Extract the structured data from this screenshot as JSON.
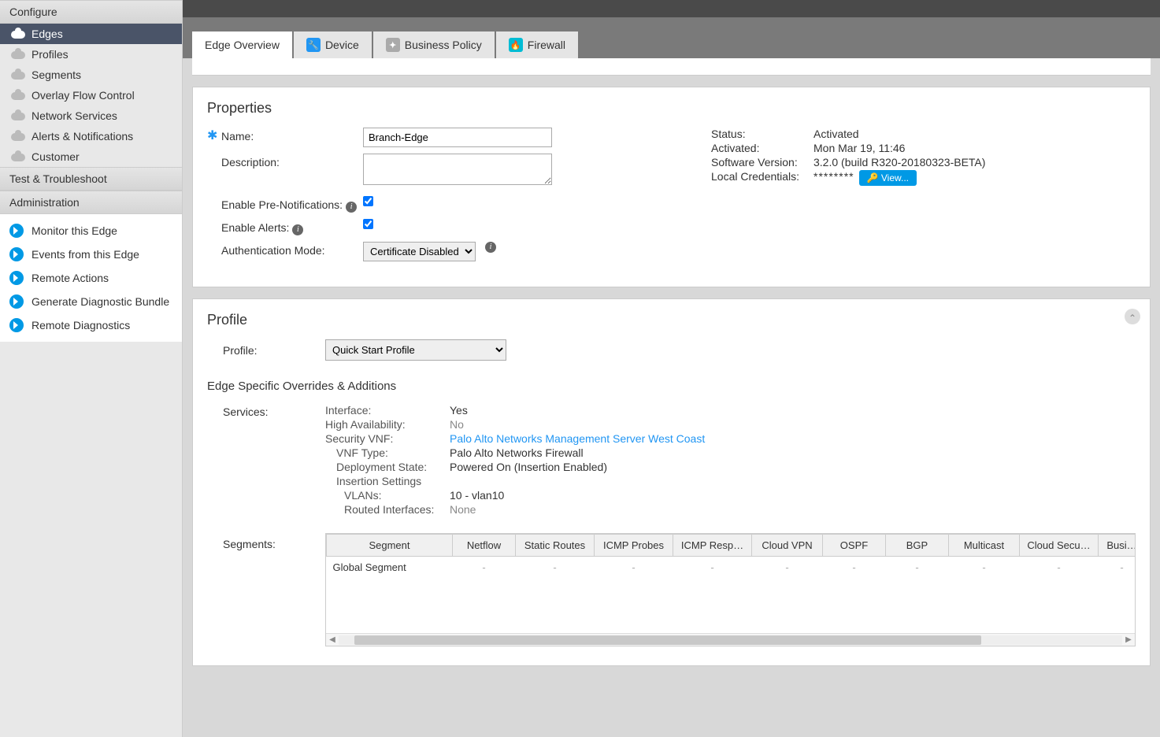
{
  "sidebar": {
    "sections": {
      "configure": "Configure",
      "test": "Test & Troubleshoot",
      "admin": "Administration"
    },
    "configure_items": [
      {
        "label": "Edges",
        "active": true
      },
      {
        "label": "Profiles"
      },
      {
        "label": "Segments"
      },
      {
        "label": "Overlay Flow Control"
      },
      {
        "label": "Network Services"
      },
      {
        "label": "Alerts & Notifications"
      },
      {
        "label": "Customer"
      }
    ],
    "admin_links": [
      {
        "label": "Monitor this Edge"
      },
      {
        "label": "Events from this Edge"
      },
      {
        "label": "Remote Actions"
      },
      {
        "label": "Generate Diagnostic Bundle"
      },
      {
        "label": "Remote Diagnostics"
      }
    ]
  },
  "tabs": [
    {
      "label": "Edge Overview",
      "active": true
    },
    {
      "label": "Device",
      "icon": "blue",
      "glyph": "🔧"
    },
    {
      "label": "Business Policy",
      "icon": "gray",
      "glyph": "✦"
    },
    {
      "label": "Firewall",
      "icon": "cyan",
      "glyph": "🔥"
    }
  ],
  "properties": {
    "heading": "Properties",
    "name_label": "Name:",
    "name_value": "Branch-Edge",
    "description_label": "Description:",
    "description_value": "",
    "pre_notif_label": "Enable Pre-Notifications:",
    "pre_notif_checked": true,
    "alerts_label": "Enable Alerts:",
    "alerts_checked": true,
    "auth_mode_label": "Authentication Mode:",
    "auth_mode_value": "Certificate Disabled",
    "status": {
      "status_label": "Status:",
      "status_value": "Activated",
      "activated_label": "Activated:",
      "activated_value": "Mon Mar 19, 11:46",
      "sw_label": "Software Version:",
      "sw_value": "3.2.0 (build R320-20180323-BETA)",
      "cred_label": "Local Credentials:",
      "cred_mask": "********",
      "view_btn": "View..."
    }
  },
  "profile": {
    "heading": "Profile",
    "profile_label": "Profile:",
    "profile_value": "Quick Start Profile",
    "overrides_heading": "Edge Specific Overrides & Additions",
    "services_label": "Services:",
    "services": {
      "interface_k": "Interface:",
      "interface_v": "Yes",
      "ha_k": "High Availability:",
      "ha_v": "No",
      "vnf_k": "Security VNF:",
      "vnf_v": "Palo Alto Networks Management Server West Coast",
      "vnf_type_k": "VNF Type:",
      "vnf_type_v": "Palo Alto Networks Firewall",
      "deploy_k": "Deployment State:",
      "deploy_v": "Powered On (Insertion Enabled)",
      "insertion_k": "Insertion Settings",
      "vlans_k": "VLANs:",
      "vlans_v": "10 - vlan10",
      "routed_k": "Routed Interfaces:",
      "routed_v": "None"
    },
    "segments_label": "Segments:",
    "seg_headers": [
      "Segment",
      "Netflow",
      "Static Routes",
      "ICMP Probes",
      "ICMP Resp…",
      "Cloud VPN",
      "OSPF",
      "BGP",
      "Multicast",
      "Cloud Secu…",
      "Busi…"
    ],
    "seg_row": {
      "name": "Global Segment",
      "cells": [
        "-",
        "-",
        "-",
        "-",
        "-",
        "-",
        "-",
        "-",
        "-",
        "-"
      ]
    }
  }
}
